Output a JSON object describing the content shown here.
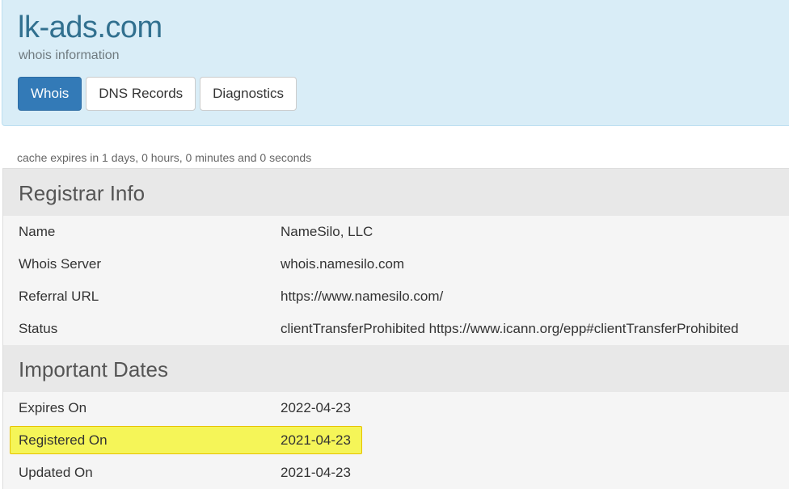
{
  "header": {
    "domain": "lk-ads.com",
    "subtitle": "whois information",
    "tabs": [
      {
        "label": "Whois",
        "active": true
      },
      {
        "label": "DNS Records",
        "active": false
      },
      {
        "label": "Diagnostics",
        "active": false
      }
    ]
  },
  "cache_note": "cache expires in 1 days, 0 hours, 0 minutes and 0 seconds",
  "registrar_info": {
    "heading": "Registrar Info",
    "rows": [
      {
        "label": "Name",
        "value": "NameSilo, LLC"
      },
      {
        "label": "Whois Server",
        "value": "whois.namesilo.com"
      },
      {
        "label": "Referral URL",
        "value": "https://www.namesilo.com/"
      },
      {
        "label": "Status",
        "value": "clientTransferProhibited https://www.icann.org/epp#clientTransferProhibited"
      }
    ]
  },
  "important_dates": {
    "heading": "Important Dates",
    "rows": [
      {
        "label": "Expires On",
        "value": "2022-04-23"
      },
      {
        "label": "Registered On",
        "value": "2021-04-23",
        "highlighted": true
      },
      {
        "label": "Updated On",
        "value": "2021-04-23"
      }
    ]
  },
  "colors": {
    "header_bg": "#d9edf7",
    "title": "#31708f",
    "active_tab": "#337ab7",
    "highlight": "#f5f53c"
  }
}
